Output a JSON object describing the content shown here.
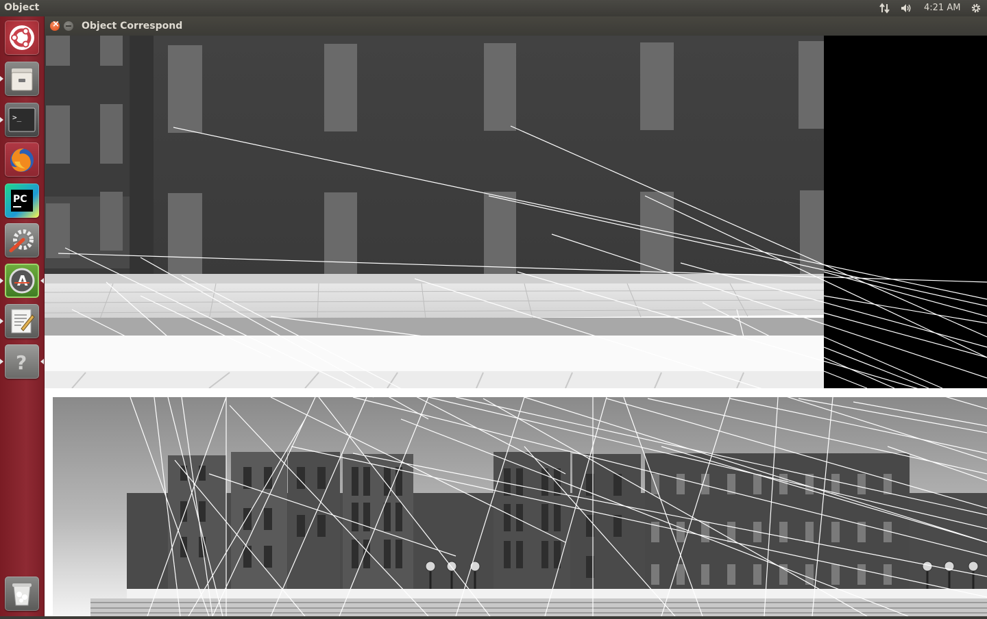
{
  "top_panel": {
    "app_name": "Object",
    "clock": "4:21 AM",
    "tray_icons": [
      "network-arrows-icon",
      "volume-icon",
      "settings-gear-icon"
    ]
  },
  "launcher": {
    "items": [
      {
        "name": "ubuntu-dash",
        "icon": "ubuntu-logo-icon"
      },
      {
        "name": "files",
        "icon": "file-cabinet-icon"
      },
      {
        "name": "terminal",
        "icon": "terminal-icon"
      },
      {
        "name": "firefox",
        "icon": "firefox-icon"
      },
      {
        "name": "pycharm",
        "icon": "pycharm-icon",
        "label": "PC"
      },
      {
        "name": "system-settings",
        "icon": "settings-wrench-icon"
      },
      {
        "name": "software-updater",
        "icon": "software-updater-icon",
        "label": "A"
      },
      {
        "name": "text-editor",
        "icon": "text-editor-icon"
      },
      {
        "name": "help",
        "icon": "help-icon",
        "label": "?"
      },
      {
        "name": "trash",
        "icon": "trash-icon"
      }
    ]
  },
  "window": {
    "title": "Object Correspond"
  },
  "colors": {
    "panel": "#3c3b37",
    "launcher": "#8e2a33",
    "close_button": "#dd4814"
  }
}
